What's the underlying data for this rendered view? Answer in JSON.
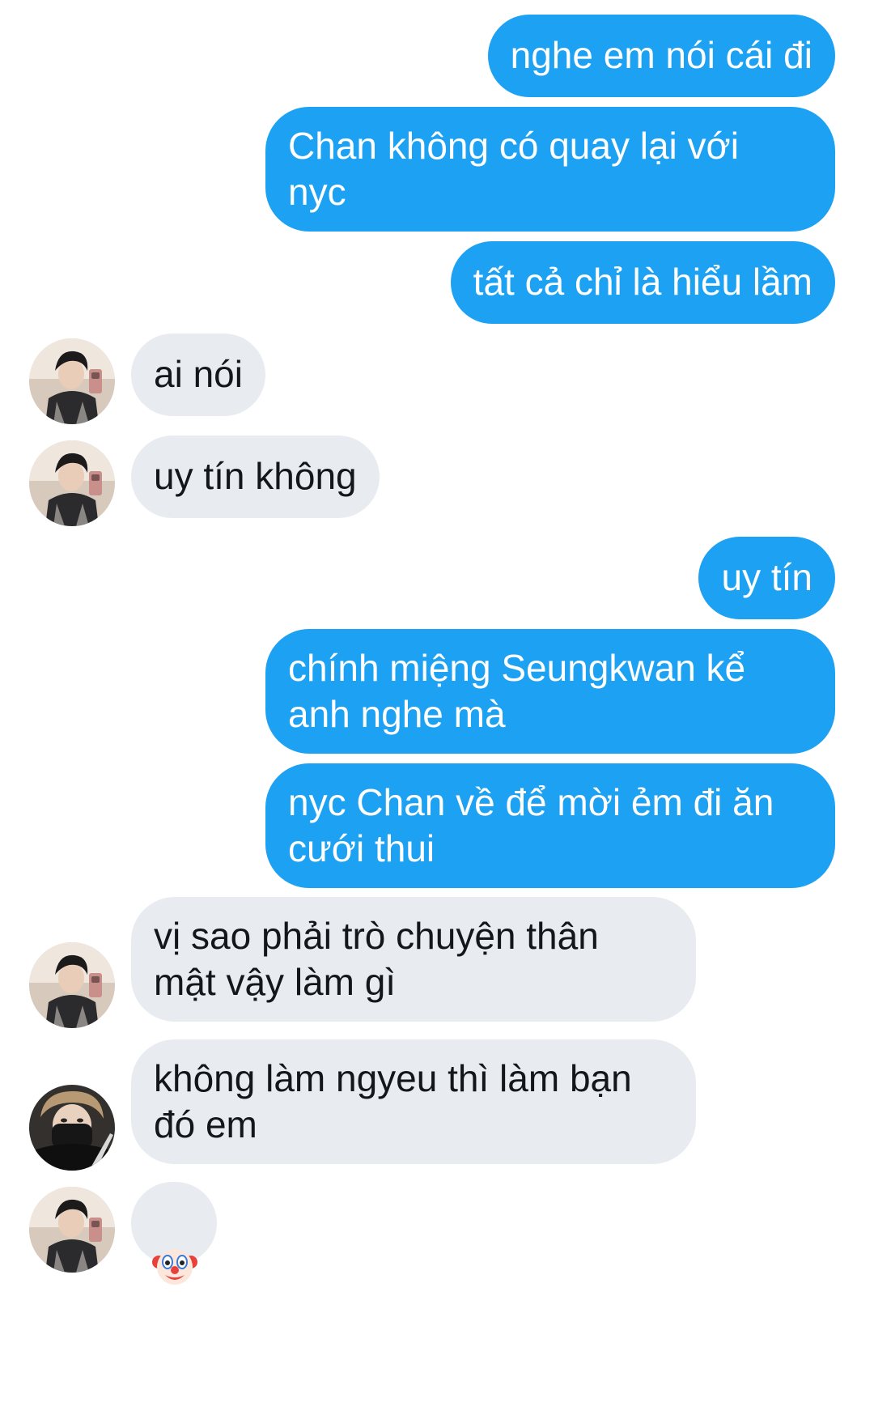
{
  "thread": {
    "messages": [
      {
        "from": "me",
        "text": "nghe em nói cái đi"
      },
      {
        "from": "me",
        "text": "Chan không có quay lại với\nnyc"
      },
      {
        "from": "me",
        "text": "tất cả chỉ là hiểu lầm"
      },
      {
        "from": "them",
        "text": "ai nói",
        "avatar": "avatar-mirror-selfie"
      },
      {
        "from": "them",
        "text": "uy tín không",
        "avatar": "avatar-mirror-selfie"
      },
      {
        "from": "me",
        "text": "uy tín"
      },
      {
        "from": "me",
        "text": "chính miệng Seungkwan kể\nanh nghe mà"
      },
      {
        "from": "me",
        "text": "nyc Chan về để mời ẻm đi ăn\ncưới thui"
      },
      {
        "from": "them",
        "text": "vị sao phải trò chuyện thân\nmật vậy làm gì",
        "avatar": "avatar-mirror-selfie"
      },
      {
        "from": "them",
        "text": "không làm ngyeu thì làm bạn\nđó em",
        "avatar": "avatar-masked"
      },
      {
        "from": "them",
        "emoji": "clown-face-icon",
        "avatar": "avatar-mirror-selfie"
      }
    ]
  },
  "colors": {
    "sent_bubble": "#1da1f2",
    "received_bubble": "#e8ecf0",
    "sent_text": "#ffffff",
    "received_text": "#14171a"
  }
}
